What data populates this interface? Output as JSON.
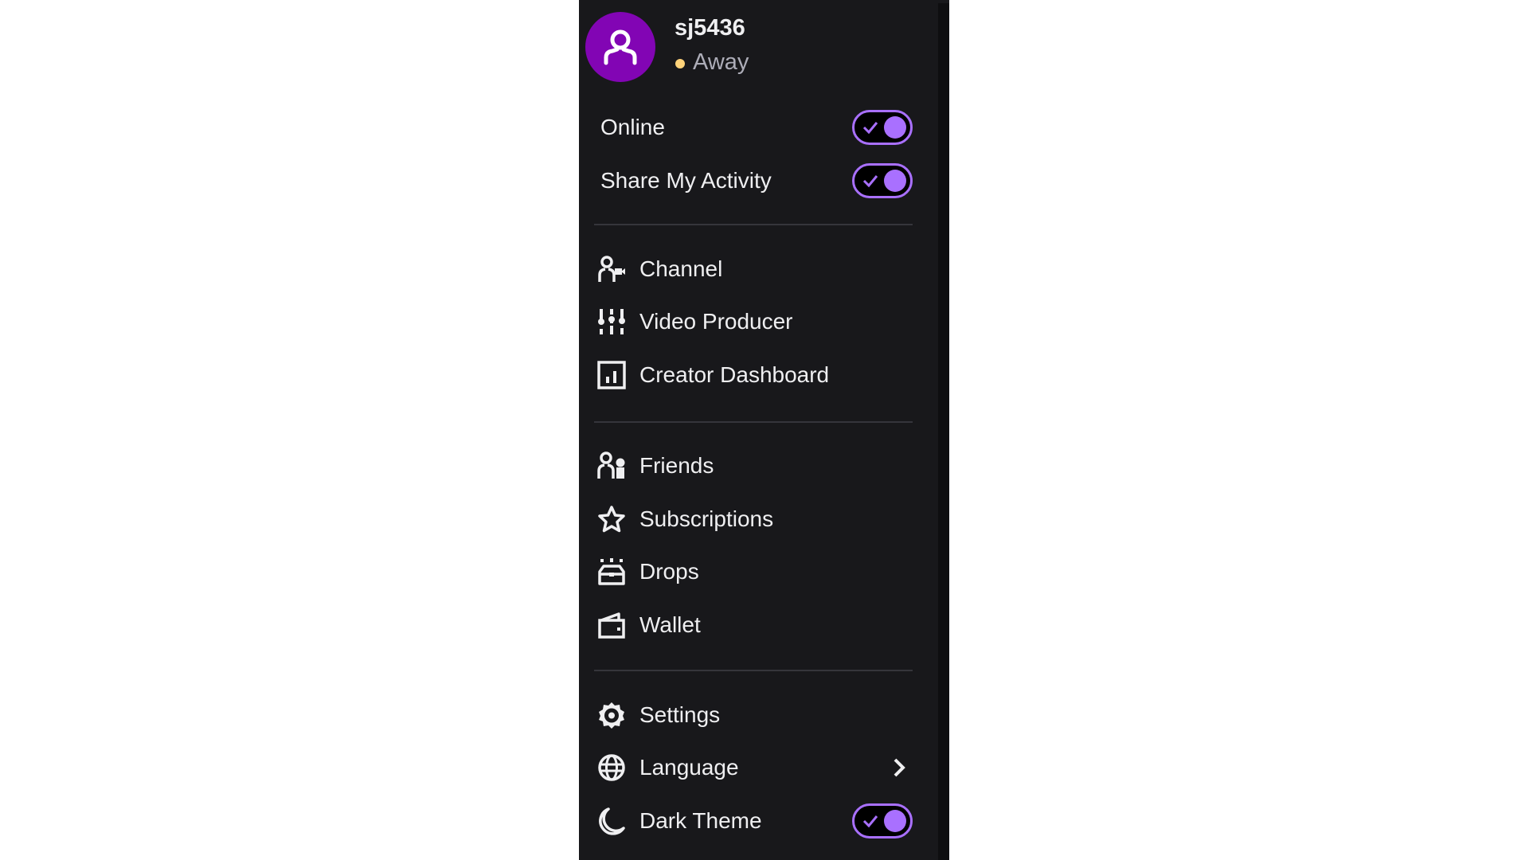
{
  "user": {
    "name": "sj5436",
    "status": "Away",
    "avatar_color": "#8205b4",
    "status_color": "#ffd37a"
  },
  "toggles": [
    {
      "label": "Online",
      "on": true
    },
    {
      "label": "Share My Activity",
      "on": true
    }
  ],
  "menu_group_1": [
    {
      "label": "Channel",
      "icon": "channel-icon"
    },
    {
      "label": "Video Producer",
      "icon": "sliders-icon"
    },
    {
      "label": "Creator Dashboard",
      "icon": "dashboard-icon"
    }
  ],
  "menu_group_2": [
    {
      "label": "Friends",
      "icon": "friends-icon"
    },
    {
      "label": "Subscriptions",
      "icon": "star-icon"
    },
    {
      "label": "Drops",
      "icon": "drops-icon"
    },
    {
      "label": "Wallet",
      "icon": "wallet-icon"
    }
  ],
  "menu_group_3": [
    {
      "label": "Settings",
      "icon": "gear-icon"
    },
    {
      "label": "Language",
      "icon": "globe-icon",
      "submenu": true
    },
    {
      "label": "Dark Theme",
      "icon": "moon-icon",
      "toggle_on": true
    }
  ],
  "accent_color": "#a970ff"
}
